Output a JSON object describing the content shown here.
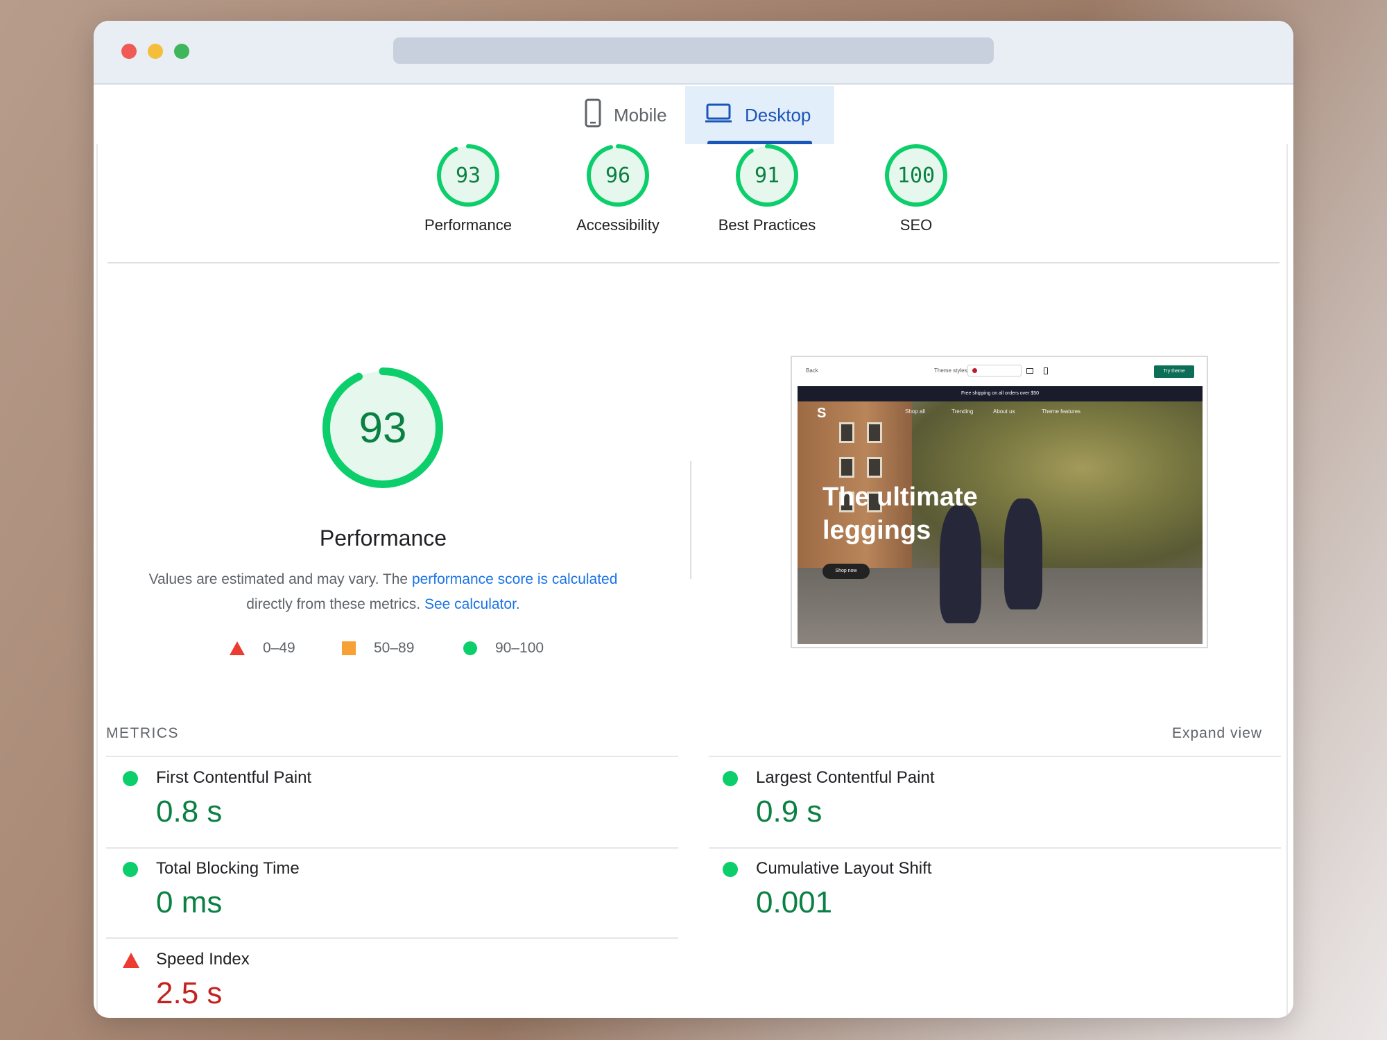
{
  "tabs": [
    {
      "label": "Mobile",
      "icon": "smartphone-icon",
      "selected": false
    },
    {
      "label": "Desktop",
      "icon": "laptop-icon",
      "selected": true
    }
  ],
  "categories": [
    {
      "score": "93",
      "label": "Performance",
      "fraction": 0.93
    },
    {
      "score": "96",
      "label": "Accessibility",
      "fraction": 0.96
    },
    {
      "score": "91",
      "label": "Best Practices",
      "fraction": 0.91
    },
    {
      "score": "100",
      "label": "SEO",
      "fraction": 1.0
    }
  ],
  "performance": {
    "score": "93",
    "fraction": 0.93,
    "title": "Performance",
    "desc_prefix": "Values are estimated and may vary. The ",
    "desc_link": "performance score is calculated",
    "desc_middle": " directly from these metrics. ",
    "calc_link": "See calculator."
  },
  "legend": [
    {
      "range": "0–49",
      "shape": "triangle",
      "color": "#eb3b32"
    },
    {
      "range": "50–89",
      "shape": "square",
      "color": "#f7a035"
    },
    {
      "range": "90–100",
      "shape": "circle",
      "color": "#0cce6b"
    }
  ],
  "thumbnail": {
    "back": "Back",
    "styles": "Theme styles",
    "try_button": "Try theme",
    "banner": "Free shipping on all orders over $50",
    "nav": [
      "Shop all",
      "Trending",
      "About us",
      "Theme features"
    ],
    "headline_1": "The ultimate",
    "headline_2": "leggings",
    "shop_button": "Shop now"
  },
  "metrics": {
    "heading": "METRICS",
    "expand": "Expand view",
    "items": [
      {
        "name": "First Contentful Paint",
        "value": "0.8 s",
        "status": "good"
      },
      {
        "name": "Largest Contentful Paint",
        "value": "0.9 s",
        "status": "good"
      },
      {
        "name": "Total Blocking Time",
        "value": "0 ms",
        "status": "good"
      },
      {
        "name": "Cumulative Layout Shift",
        "value": "0.001",
        "status": "good"
      },
      {
        "name": "Speed Index",
        "value": "2.5 s",
        "status": "bad"
      }
    ]
  },
  "colors": {
    "good": "#0cce6b",
    "good_text": "#0b8043",
    "bad": "#eb3b32",
    "average": "#f7a035",
    "link": "#1a73e8",
    "tab_active": "#1a55b8"
  }
}
